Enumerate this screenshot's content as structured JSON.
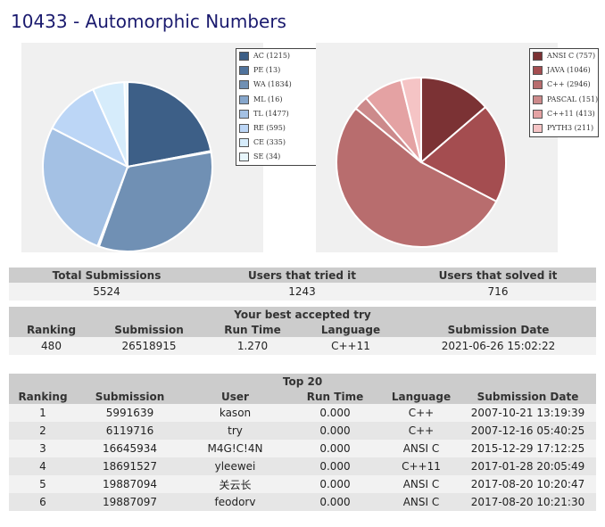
{
  "page": {
    "title": "10433 - Automorphic Numbers"
  },
  "verdicts": {
    "items": [
      {
        "label": "AC (1215)",
        "value": 1215,
        "color": "#3d5f87"
      },
      {
        "label": "PE (13)",
        "value": 13,
        "color": "#50739c"
      },
      {
        "label": "WA (1834)",
        "value": 1834,
        "color": "#7090b4"
      },
      {
        "label": "ML (16)",
        "value": 16,
        "color": "#86a6cb"
      },
      {
        "label": "TL (1477)",
        "value": 1477,
        "color": "#a4c1e4"
      },
      {
        "label": "RE (595)",
        "value": 595,
        "color": "#bcd6f6"
      },
      {
        "label": "CE (335)",
        "value": 335,
        "color": "#d6ecfb"
      },
      {
        "label": "SE (34)",
        "value": 34,
        "color": "#e8f6fc"
      }
    ]
  },
  "languages": {
    "items": [
      {
        "label": "ANSI C (757)",
        "value": 757,
        "color": "#7b3234"
      },
      {
        "label": "JAVA (1046)",
        "value": 1046,
        "color": "#a44d50"
      },
      {
        "label": "C++ (2946)",
        "value": 2946,
        "color": "#b86d6e"
      },
      {
        "label": "PASCAL (151)",
        "value": 151,
        "color": "#cc8a8b"
      },
      {
        "label": "C++11 (413)",
        "value": 413,
        "color": "#e4a2a3"
      },
      {
        "label": "PYTH3 (211)",
        "value": 211,
        "color": "#f5c4c5"
      }
    ]
  },
  "totals": {
    "headers": [
      "Total Submissions",
      "Users that tried it",
      "Users that solved it"
    ],
    "values": [
      "5524",
      "1243",
      "716"
    ]
  },
  "best": {
    "caption": "Your best accepted try",
    "headers": [
      "Ranking",
      "Submission",
      "Run Time",
      "Language",
      "Submission Date"
    ],
    "values": [
      "480",
      "26518915",
      "1.270",
      "C++11",
      "2021-06-26 15:02:22"
    ]
  },
  "top20": {
    "caption": "Top 20",
    "headers": [
      "Ranking",
      "Submission",
      "User",
      "Run Time",
      "Language",
      "Submission Date"
    ],
    "rows": [
      [
        "1",
        "5991639",
        "kason",
        "0.000",
        "C++",
        "2007-10-21 13:19:39"
      ],
      [
        "2",
        "6119716",
        "try",
        "0.000",
        "C++",
        "2007-12-16 05:40:25"
      ],
      [
        "3",
        "16645934",
        "M4G!C!4N",
        "0.000",
        "ANSI C",
        "2015-12-29 17:12:25"
      ],
      [
        "4",
        "18691527",
        "yleewei",
        "0.000",
        "C++11",
        "2017-01-28 20:05:49"
      ],
      [
        "5",
        "19887094",
        "关云长",
        "0.000",
        "ANSI C",
        "2017-08-20 10:20:47"
      ],
      [
        "6",
        "19887097",
        "feodorv",
        "0.000",
        "ANSI C",
        "2017-08-20 10:21:30"
      ]
    ]
  }
}
